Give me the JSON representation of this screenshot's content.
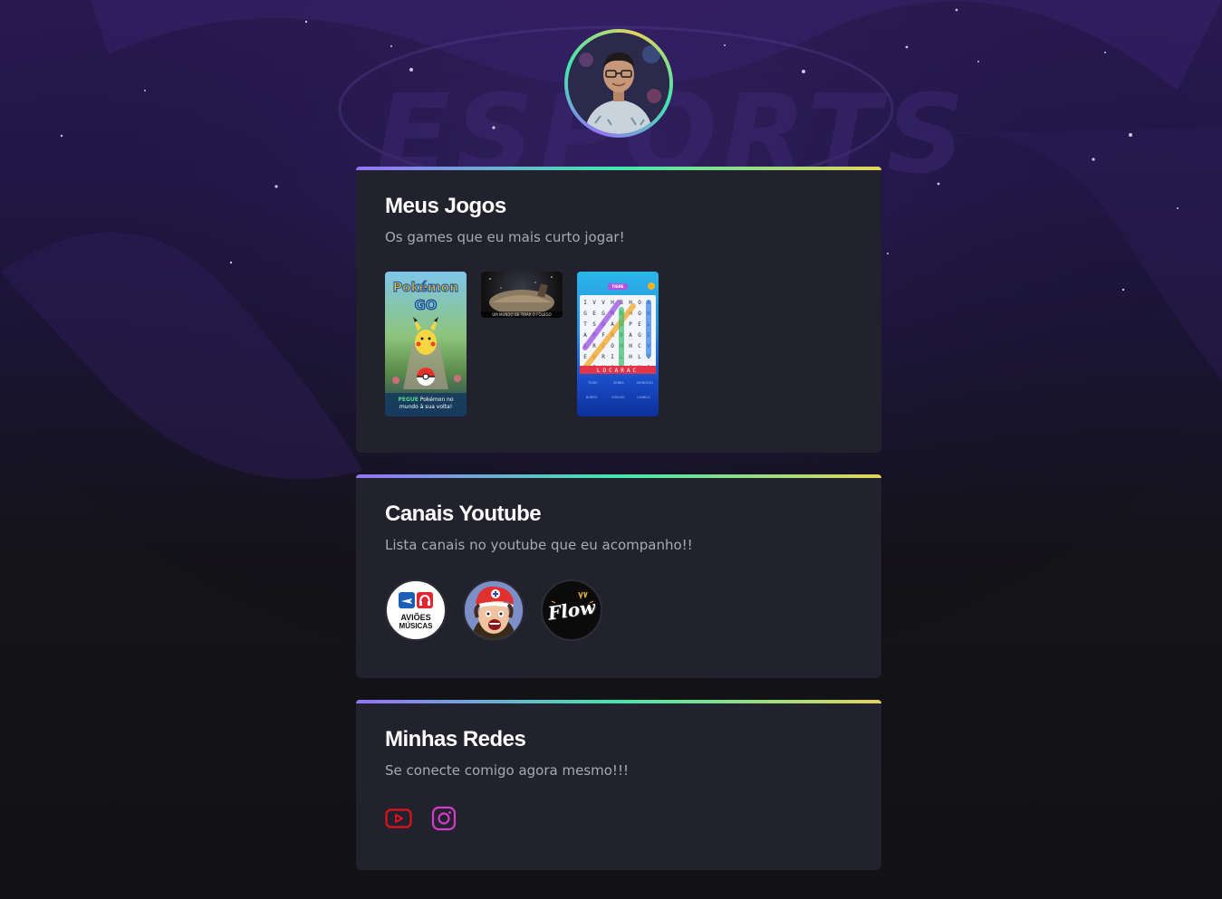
{
  "profile": {
    "avatar_alt": "Foto de perfil"
  },
  "sections": {
    "games": {
      "title": "Meus Jogos",
      "subtitle": "Os games que eu mais curto jogar!",
      "items": [
        {
          "name": "Pokémon GO",
          "logo": "Pokémon",
          "logo_sub": "GO",
          "caption_highlight": "PEGUE",
          "caption_rest": "Pokémon no mundo à sua volta!"
        },
        {
          "name": "Space game",
          "caption": "UM MUNDO DE TIRAR O FÔLEGO"
        },
        {
          "name": "Caça-palavras",
          "word_label": "TIGRE"
        }
      ]
    },
    "channels": {
      "title": "Canais Youtube",
      "subtitle": "Lista canais no youtube que eu acompanho!!",
      "items": [
        {
          "name": "Aviões e Músicas",
          "line1": "AVIÕES",
          "line2": "MÚSICAS"
        },
        {
          "name": "Canal cartoon boné"
        },
        {
          "name": "Flow",
          "label": "Flow"
        }
      ]
    },
    "social": {
      "title": "Minhas Redes",
      "subtitle": "Se conecte comigo agora mesmo!!!",
      "items": [
        {
          "icon": "youtube-icon",
          "color": "#e0121b"
        },
        {
          "icon": "instagram-icon",
          "color": "#d63bc9"
        }
      ]
    }
  },
  "colors": {
    "gradient_start": "#9572fc",
    "gradient_mid": "#43e7ad",
    "gradient_end": "#e2d45c",
    "card_bg": "#21222d"
  }
}
